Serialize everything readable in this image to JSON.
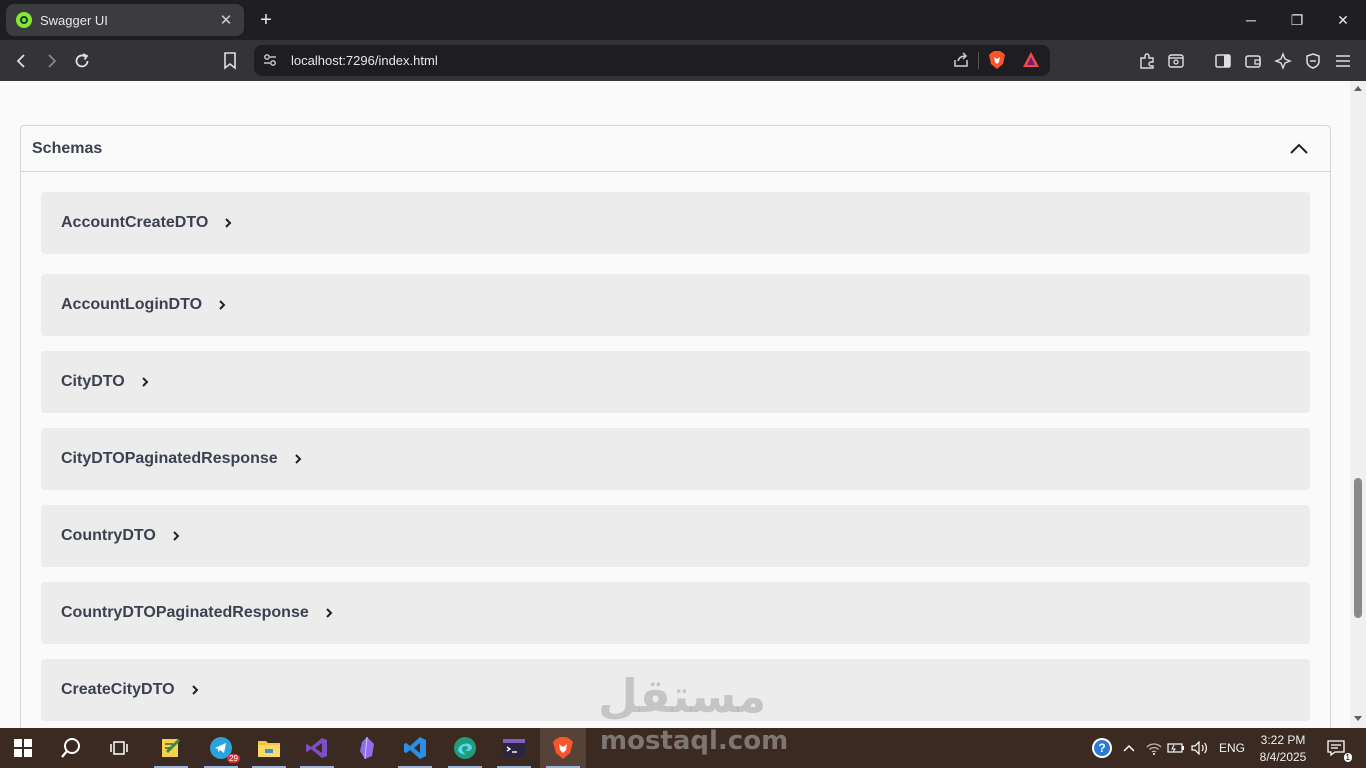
{
  "browser": {
    "tab_title": "Swagger UI",
    "tab_close": "✕",
    "new_tab": "+",
    "url": "localhost:7296/index.html",
    "window_controls": {
      "minimize": "─",
      "maximize": "❐",
      "close": "✕"
    }
  },
  "swagger": {
    "section_title": "Schemas",
    "models": [
      "AccountCreateDTO",
      "AccountLoginDTO",
      "CityDTO",
      "CityDTOPaginatedResponse",
      "CountryDTO",
      "CountryDTOPaginatedResponse",
      "CreateCityDTO"
    ]
  },
  "watermark": {
    "arabic": "مستقل",
    "latin": "mostaql.com"
  },
  "taskbar": {
    "apps": [
      "start-icon",
      "search-icon",
      "task-view-icon",
      "notepad-icon",
      "telegram-icon",
      "file-explorer-icon",
      "visual-studio-icon",
      "obsidian-icon",
      "vscode-icon",
      "edge-dev-icon",
      "terminal-icon",
      "brave-icon"
    ],
    "telegram_badge": "29",
    "language": "ENG",
    "time": "3:22 PM",
    "date": "8/4/2025",
    "notifications": "1"
  }
}
